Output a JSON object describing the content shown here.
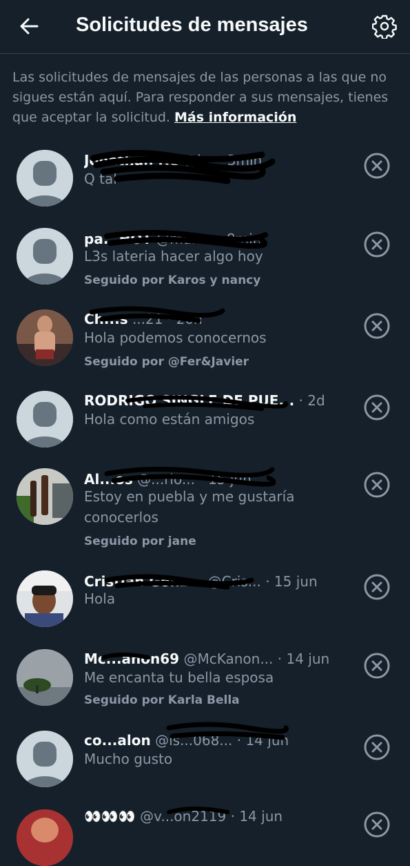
{
  "header": {
    "title": "Solicitudes de mensajes",
    "back_icon": "arrow-left-icon",
    "settings_icon": "gear-icon"
  },
  "intro": {
    "text": "Las solicitudes de mensajes de las personas a las que no sigues están aquí. Para responder a sus mensajes, tienes que aceptar la solicitud. ",
    "link": "Más información"
  },
  "requests": [
    {
      "name": "Jonathan He",
      "handle": "@j...",
      "time": "· 3min",
      "message": "Q tal",
      "followed_by": ""
    },
    {
      "name": "pa...HOT",
      "handle": "@man...",
      "time": "· 8min",
      "message": "L3s lateria hacer algo hoy",
      "followed_by": "Seguido por Karos y nancy"
    },
    {
      "name": "Ch...s",
      "handle": "...21",
      "time": "· 20h",
      "message": "Hola podemos conocernos",
      "followed_by": "Seguido por @Fer&Javier"
    },
    {
      "name": "RODRIGO SINGLE DE PUE...",
      "handle": "",
      "time": "· 2d",
      "message": "Hola como están amigos",
      "followed_by": ""
    },
    {
      "name": "Al...os",
      "handle": "@...rio...",
      "time": "· 15 jun",
      "message": "Estoy en puebla y me gustaría conocerlos",
      "followed_by": "Seguido por jane"
    },
    {
      "name": "Cristian Gonz...",
      "handle": "@Cris...",
      "time": "· 15 jun",
      "message": "Hola",
      "followed_by": ""
    },
    {
      "name": "Mc...anon69",
      "handle": "@McKanon...",
      "time": "· 14 jun",
      "message": "Me encanta tu bella esposa",
      "followed_by": "Seguido por Karla Bella"
    },
    {
      "name": "co...alon",
      "handle": "@is...068...",
      "time": "· 14 jun",
      "message": "Mucho gusto",
      "followed_by": ""
    },
    {
      "name": "👀👀👀",
      "handle": "@v...on2119",
      "time": "· 14 jun",
      "message": "",
      "followed_by": ""
    }
  ]
}
